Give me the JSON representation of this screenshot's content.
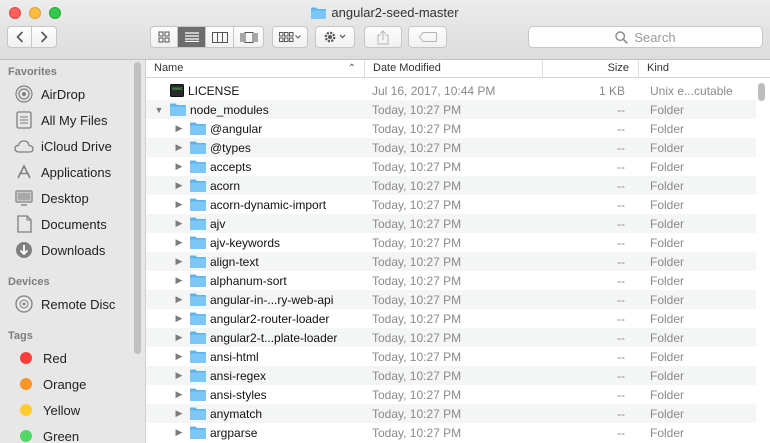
{
  "window": {
    "title": "angular2-seed-master"
  },
  "toolbar": {
    "back_icon": "chevron-left-icon",
    "forward_icon": "chevron-right-icon",
    "view_modes": [
      "icon-view",
      "list-view",
      "column-view",
      "cover-flow-view"
    ],
    "active_view": "list-view",
    "arrange_icon": "arrange-icon",
    "action_icon": "gear-icon",
    "share_icon": "share-icon",
    "tag_icon": "tag-icon",
    "search_placeholder": "Search"
  },
  "sidebar": {
    "favorites_label": "Favorites",
    "favorites": [
      {
        "label": "AirDrop",
        "icon": "airdrop-icon"
      },
      {
        "label": "All My Files",
        "icon": "all-files-icon"
      },
      {
        "label": "iCloud Drive",
        "icon": "cloud-icon"
      },
      {
        "label": "Applications",
        "icon": "applications-icon"
      },
      {
        "label": "Desktop",
        "icon": "desktop-icon"
      },
      {
        "label": "Documents",
        "icon": "documents-icon"
      },
      {
        "label": "Downloads",
        "icon": "downloads-icon"
      }
    ],
    "devices_label": "Devices",
    "devices": [
      {
        "label": "Remote Disc",
        "icon": "disc-icon"
      }
    ],
    "tags_label": "Tags",
    "tags": [
      {
        "label": "Red",
        "color": "#fc3d39"
      },
      {
        "label": "Orange",
        "color": "#fd9426"
      },
      {
        "label": "Yellow",
        "color": "#fecb2f"
      },
      {
        "label": "Green",
        "color": "#53d769"
      }
    ]
  },
  "columns": {
    "name": "Name",
    "date": "Date Modified",
    "size": "Size",
    "kind": "Kind"
  },
  "files": [
    {
      "name": "LICENSE",
      "date": "Jul 16, 2017, 10:44 PM",
      "size": "1 KB",
      "kind": "Unix e...cutable",
      "type": "exec",
      "level": 0,
      "expanded": false
    },
    {
      "name": "node_modules",
      "date": "Today, 10:27 PM",
      "size": "--",
      "kind": "Folder",
      "type": "folder",
      "level": 0,
      "expanded": true
    },
    {
      "name": "@angular",
      "date": "Today, 10:27 PM",
      "size": "--",
      "kind": "Folder",
      "type": "folder",
      "level": 1,
      "expanded": false
    },
    {
      "name": "@types",
      "date": "Today, 10:27 PM",
      "size": "--",
      "kind": "Folder",
      "type": "folder",
      "level": 1,
      "expanded": false
    },
    {
      "name": "accepts",
      "date": "Today, 10:27 PM",
      "size": "--",
      "kind": "Folder",
      "type": "folder",
      "level": 1,
      "expanded": false
    },
    {
      "name": "acorn",
      "date": "Today, 10:27 PM",
      "size": "--",
      "kind": "Folder",
      "type": "folder",
      "level": 1,
      "expanded": false
    },
    {
      "name": "acorn-dynamic-import",
      "date": "Today, 10:27 PM",
      "size": "--",
      "kind": "Folder",
      "type": "folder",
      "level": 1,
      "expanded": false
    },
    {
      "name": "ajv",
      "date": "Today, 10:27 PM",
      "size": "--",
      "kind": "Folder",
      "type": "folder",
      "level": 1,
      "expanded": false
    },
    {
      "name": "ajv-keywords",
      "date": "Today, 10:27 PM",
      "size": "--",
      "kind": "Folder",
      "type": "folder",
      "level": 1,
      "expanded": false
    },
    {
      "name": "align-text",
      "date": "Today, 10:27 PM",
      "size": "--",
      "kind": "Folder",
      "type": "folder",
      "level": 1,
      "expanded": false
    },
    {
      "name": "alphanum-sort",
      "date": "Today, 10:27 PM",
      "size": "--",
      "kind": "Folder",
      "type": "folder",
      "level": 1,
      "expanded": false
    },
    {
      "name": "angular-in-...ry-web-api",
      "date": "Today, 10:27 PM",
      "size": "--",
      "kind": "Folder",
      "type": "folder",
      "level": 1,
      "expanded": false
    },
    {
      "name": "angular2-router-loader",
      "date": "Today, 10:27 PM",
      "size": "--",
      "kind": "Folder",
      "type": "folder",
      "level": 1,
      "expanded": false
    },
    {
      "name": "angular2-t...plate-loader",
      "date": "Today, 10:27 PM",
      "size": "--",
      "kind": "Folder",
      "type": "folder",
      "level": 1,
      "expanded": false
    },
    {
      "name": "ansi-html",
      "date": "Today, 10:27 PM",
      "size": "--",
      "kind": "Folder",
      "type": "folder",
      "level": 1,
      "expanded": false
    },
    {
      "name": "ansi-regex",
      "date": "Today, 10:27 PM",
      "size": "--",
      "kind": "Folder",
      "type": "folder",
      "level": 1,
      "expanded": false
    },
    {
      "name": "ansi-styles",
      "date": "Today, 10:27 PM",
      "size": "--",
      "kind": "Folder",
      "type": "folder",
      "level": 1,
      "expanded": false
    },
    {
      "name": "anymatch",
      "date": "Today, 10:27 PM",
      "size": "--",
      "kind": "Folder",
      "type": "folder",
      "level": 1,
      "expanded": false
    },
    {
      "name": "argparse",
      "date": "Today, 10:27 PM",
      "size": "--",
      "kind": "Folder",
      "type": "folder",
      "level": 1,
      "expanded": false
    }
  ]
}
